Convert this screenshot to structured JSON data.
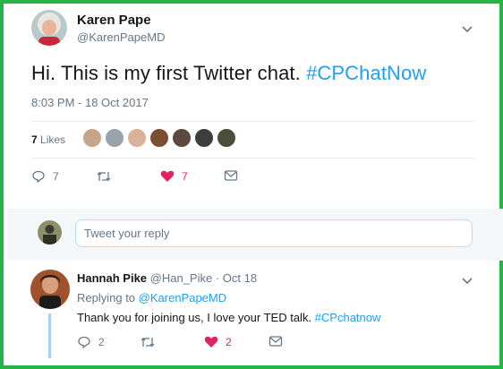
{
  "tweet": {
    "author_name": "Karen Pape",
    "author_handle": "@KarenPapeMD",
    "text_plain": "Hi. This is my first Twitter chat. ",
    "text_hashtag": "#CPChatNow",
    "timestamp": "8:03 PM - 18 Oct 2017",
    "likes_count": "7",
    "likes_label": "Likes",
    "actions": {
      "reply_count": "7",
      "retweet_count": "",
      "like_count": "7"
    },
    "likers": [
      {
        "icon": "liker-avatar",
        "color": "#c8a48a"
      },
      {
        "icon": "liker-avatar",
        "color": "#9aa3ab"
      },
      {
        "icon": "liker-avatar",
        "color": "#d9b29a"
      },
      {
        "icon": "liker-avatar",
        "color": "#7a4e33"
      },
      {
        "icon": "liker-avatar",
        "color": "#5c4a3f"
      },
      {
        "icon": "liker-avatar",
        "color": "#3d3d3d"
      },
      {
        "icon": "liker-avatar",
        "color": "#4a4f3a"
      }
    ]
  },
  "reply_box": {
    "placeholder": "Tweet your reply"
  },
  "reply": {
    "author_name": "Hannah Pike",
    "author_handle": "@Han_Pike",
    "separator": " · ",
    "date": "Oct 18",
    "replying_prefix": "Replying to ",
    "replying_to": "@KarenPapeMD",
    "text_plain": "Thank you for joining us, I love your TED talk. ",
    "text_hashtag": "#CPchatnow",
    "actions": {
      "reply_count": "2",
      "retweet_count": "",
      "like_count": "2"
    }
  },
  "colors": {
    "frame": "#25b34a",
    "link": "#1da1f2",
    "like": "#e0245e",
    "muted": "#657786"
  }
}
